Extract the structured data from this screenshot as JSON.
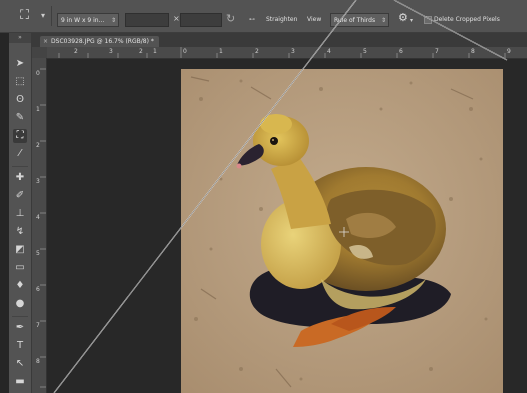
{
  "options_bar": {
    "size_preset": "9 in W x 9 in...",
    "straighten": "Straighten",
    "view_label": "View",
    "view_value": "Rule of Thirds",
    "delete_cropped": "Delete Cropped Pixels"
  },
  "document": {
    "tab_title": "DSC03928.JPG @ 16.7% (RGB/8) *",
    "ruler_top": [
      "2",
      "3",
      "2",
      "1",
      "0",
      "1",
      "2",
      "3",
      "4",
      "5",
      "6",
      "7",
      "8",
      "9"
    ],
    "ruler_left": [
      "0",
      "1",
      "2",
      "3",
      "4",
      "5",
      "6",
      "7",
      "8"
    ]
  },
  "colors": {
    "panel": "#535353",
    "canvas_bg": "#282828",
    "photo_ground": "#b39a7c",
    "gosling_yellow": "#c9a244"
  },
  "icons": {
    "crop_tool": "crop-icon",
    "swap": "swap-icon",
    "settings": "gear-icon"
  }
}
